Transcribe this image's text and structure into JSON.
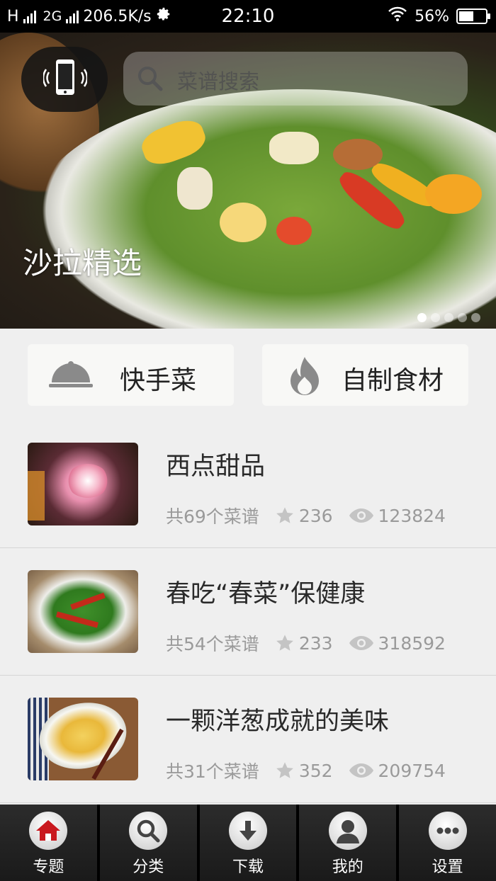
{
  "status_bar": {
    "carrier": "H",
    "network": "2G",
    "speed": "206.5K/s",
    "time": "22:10",
    "battery": "56%",
    "battery_fraction": 0.56
  },
  "banner": {
    "search_placeholder": "菜谱搜索",
    "title": "沙拉精选",
    "page_count": 5,
    "active_page": 0
  },
  "quick_actions": [
    {
      "label": "快手菜",
      "icon": "cloche-icon"
    },
    {
      "label": "自制食材",
      "icon": "flame-icon"
    }
  ],
  "topics": [
    {
      "title": "西点甜品",
      "count": "共69个菜谱",
      "stars": "236",
      "views": "123824"
    },
    {
      "title": "春吃“春菜”保健康",
      "count": "共54个菜谱",
      "stars": "233",
      "views": "318592"
    },
    {
      "title": "一颗洋葱成就的美味",
      "count": "共31个菜谱",
      "stars": "352",
      "views": "209754"
    }
  ],
  "nav": {
    "items": [
      {
        "label": "专题",
        "icon": "home-icon"
      },
      {
        "label": "分类",
        "icon": "search-icon"
      },
      {
        "label": "下载",
        "icon": "download-icon"
      },
      {
        "label": "我的",
        "icon": "user-icon"
      },
      {
        "label": "设置",
        "icon": "more-icon"
      }
    ]
  }
}
